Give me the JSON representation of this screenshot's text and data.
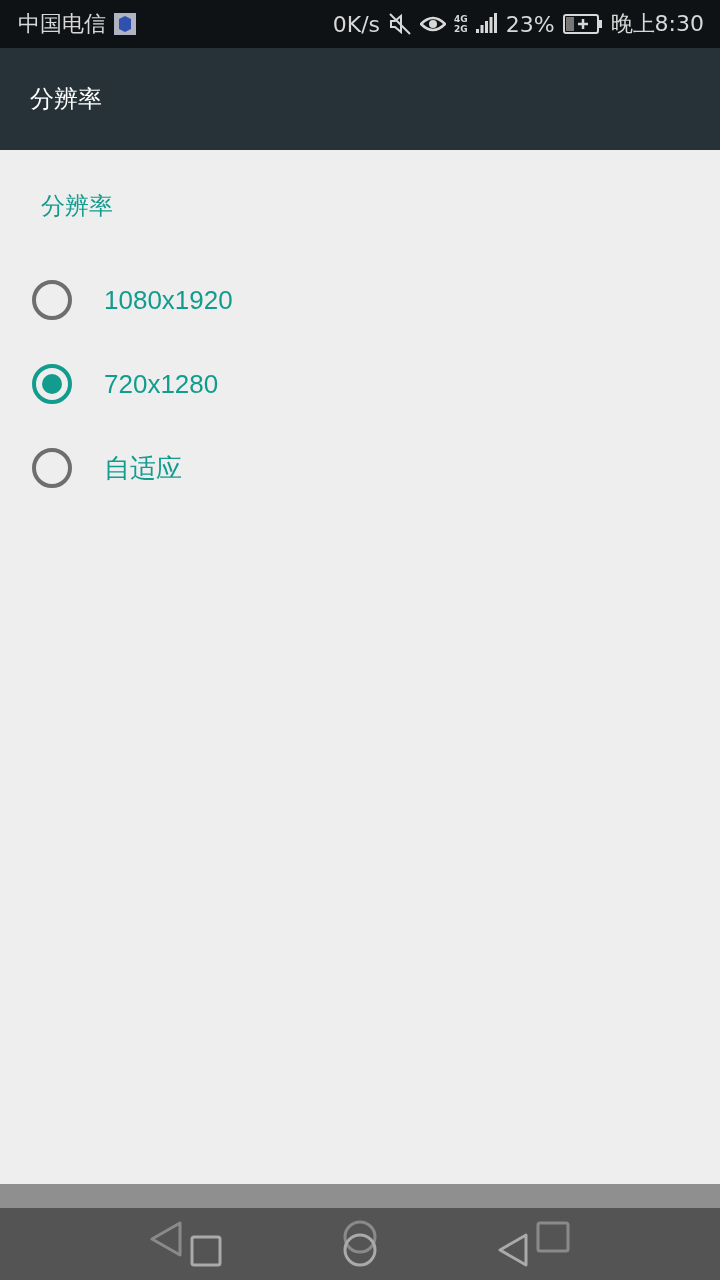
{
  "status_bar": {
    "carrier": "中国电信",
    "speed": "0K/s",
    "network": "4G\n2G",
    "battery": "23%",
    "time": "晚上8:30"
  },
  "app_bar": {
    "title": "分辨率"
  },
  "section": {
    "title": "分辨率"
  },
  "options": [
    {
      "label": "1080x1920",
      "selected": false
    },
    {
      "label": "720x1280",
      "selected": true
    },
    {
      "label": "自适应",
      "selected": false
    }
  ]
}
